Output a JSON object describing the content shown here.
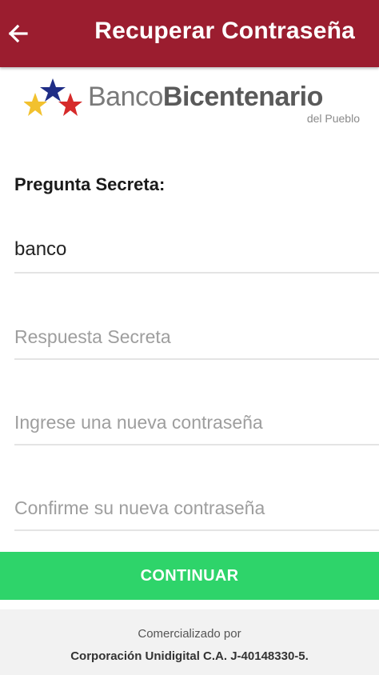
{
  "appbar": {
    "title": "Recuperar Contraseña",
    "color": "#9b1d2f",
    "back_icon": "arrow-left-icon"
  },
  "logo": {
    "word_light": "Banco",
    "word_bold": "Bicentenario",
    "subtitle": "del Pueblo",
    "star_colors": [
      "#1f2d86",
      "#f2c12e",
      "#d62a2a"
    ]
  },
  "form": {
    "question_label": "Pregunta Secreta:",
    "question_value": "banco",
    "answer_placeholder": "Respuesta Secreta",
    "new_password_placeholder": "Ingrese una nueva contraseña",
    "confirm_password_placeholder": "Confirme su nueva contraseña"
  },
  "button": {
    "label": "CONTINUAR",
    "color": "#2ed46a"
  },
  "footer": {
    "line1": "Comercializado por",
    "line2": "Corporación Unidigital C.A. J-40148330-5."
  }
}
